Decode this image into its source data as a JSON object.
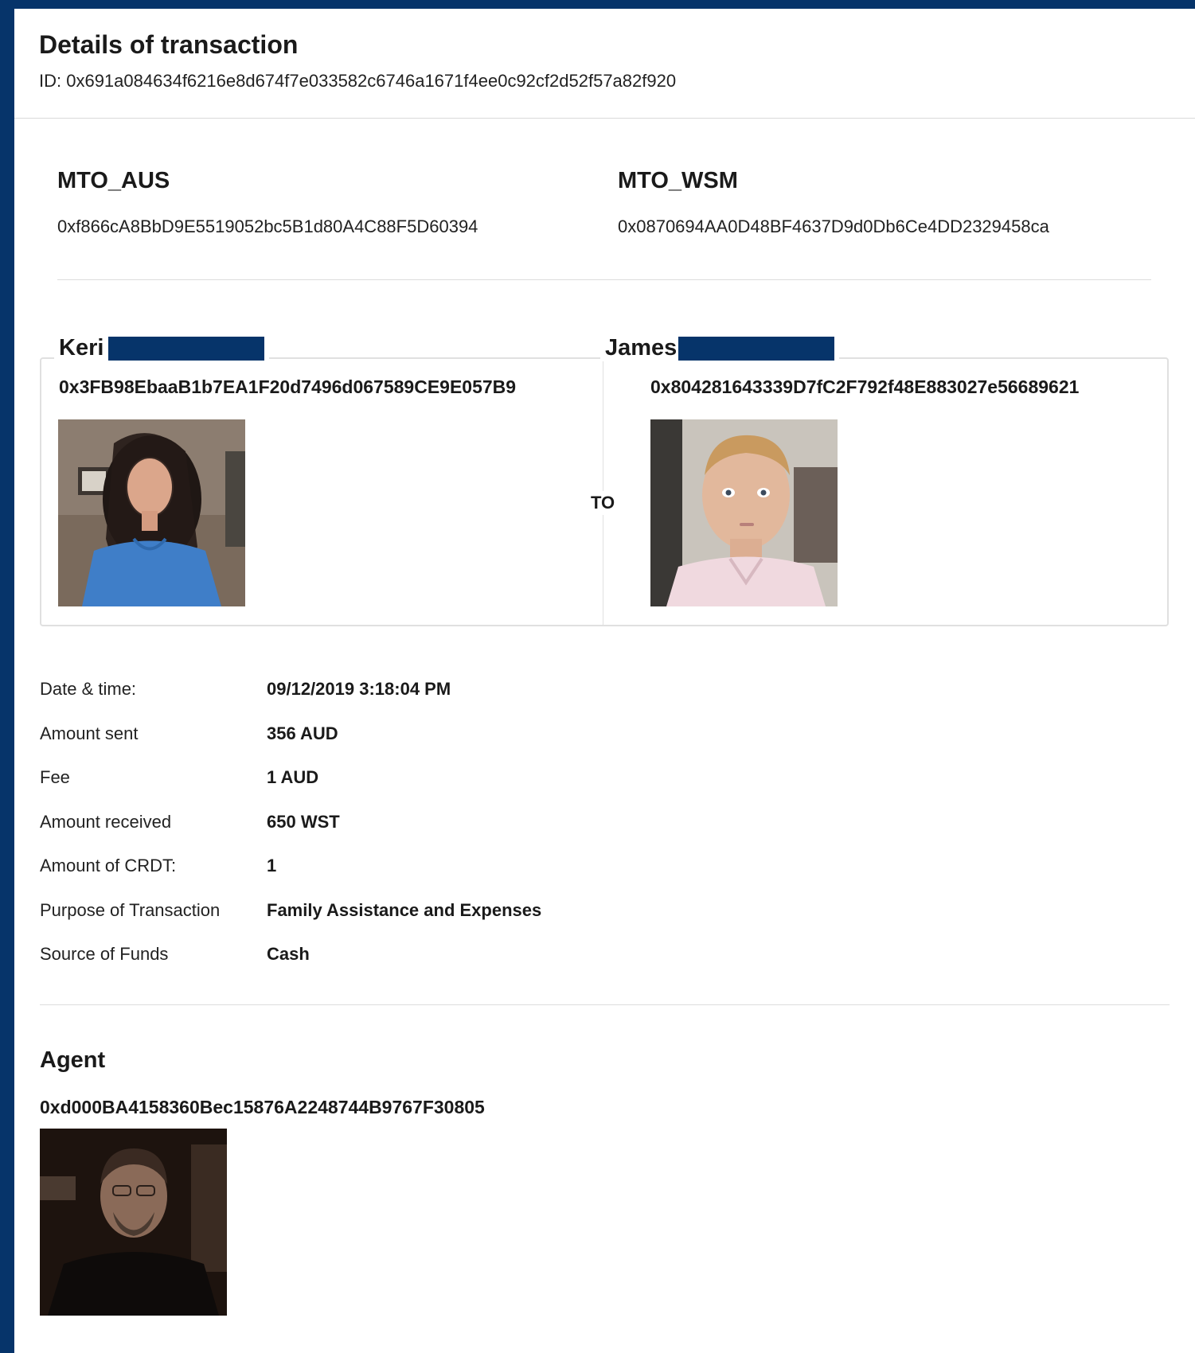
{
  "header": {
    "title": "Details of transaction",
    "id_text": "ID: 0x691a084634f6216e8d674f7e033582c6746a1671f4ee0c92cf2d52f57a82f920"
  },
  "mtos": [
    {
      "name": "MTO_AUS",
      "address": "0xf866cA8BbD9E5519052bc5B1d80A4C88F5D60394"
    },
    {
      "name": "MTO_WSM",
      "address": "0x0870694AA0D48BF4637D9d0Db6Ce4DD2329458ca"
    }
  ],
  "sender": {
    "name": "Keri",
    "address": "0x3FB98EbaaB1b7EA1F20d7496d067589CE9E057B9"
  },
  "connector": "TO",
  "recipient": {
    "name": "James",
    "address": "0x804281643339D7fC2F792f48E883027e56689621"
  },
  "details": [
    {
      "label": "Date & time:",
      "value": "09/12/2019 3:18:04 PM"
    },
    {
      "label": "Amount sent",
      "value": "356 AUD"
    },
    {
      "label": "Fee",
      "value": "1 AUD"
    },
    {
      "label": "Amount received",
      "value": "650 WST"
    },
    {
      "label": "Amount of CRDT:",
      "value": "1"
    },
    {
      "label": "Purpose of Transaction",
      "value": "Family Assistance and Expenses"
    },
    {
      "label": "Source of Funds",
      "value": "Cash"
    }
  ],
  "agent": {
    "title": "Agent",
    "address": "0xd000BA4158360Bec15876A2248744B9767F30805"
  },
  "colors": {
    "frame": "#06346a",
    "redaction": "#06346a",
    "divider": "#dcdcdc"
  }
}
